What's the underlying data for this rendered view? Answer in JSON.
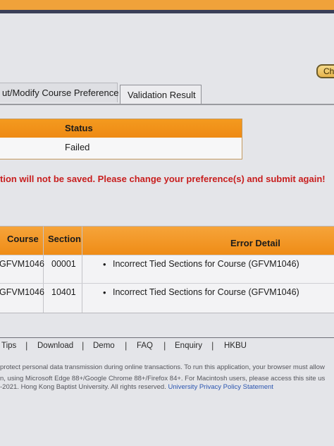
{
  "header": {
    "button_label": "Ch"
  },
  "tabs": [
    {
      "label": "ut/Modify Course Preference"
    },
    {
      "label": "Validation Result"
    }
  ],
  "status_table": {
    "header": "Status",
    "value": "Failed"
  },
  "warning": {
    "text": "tion will not be saved. Please change your preference(s) and submit again!"
  },
  "error_table": {
    "columns": [
      "Course",
      "Section",
      "Error Detail"
    ],
    "rows": [
      {
        "course": "GFVM1046",
        "section": "00001",
        "detail": "Incorrect Tied Sections for Course (GFVM1046)"
      },
      {
        "course": "GFVM1046",
        "section": "10401",
        "detail": "Incorrect Tied Sections for Course (GFVM1046)"
      }
    ],
    "bullet": "•"
  },
  "footer": {
    "nav": [
      "Tips",
      "Download",
      "Demo",
      "FAQ",
      "Enquiry",
      "HKBU"
    ],
    "separator": "|",
    "notice_line1": "protect personal data transmission during online transactions. To run this application, your browser must allow",
    "notice_line2": "n, using Microsoft Edge 88+/Google Chrome 88+/Firefox 84+. For Macintosh users, please access this site us",
    "copyright": "-2021. Hong Kong Baptist University. All rights reserved.",
    "privacy_link": "University Privacy Policy Statement"
  },
  "colors": {
    "accent_orange": "#ef8c16",
    "warning_red": "#c81e1e",
    "link_blue": "#2c56b0"
  }
}
